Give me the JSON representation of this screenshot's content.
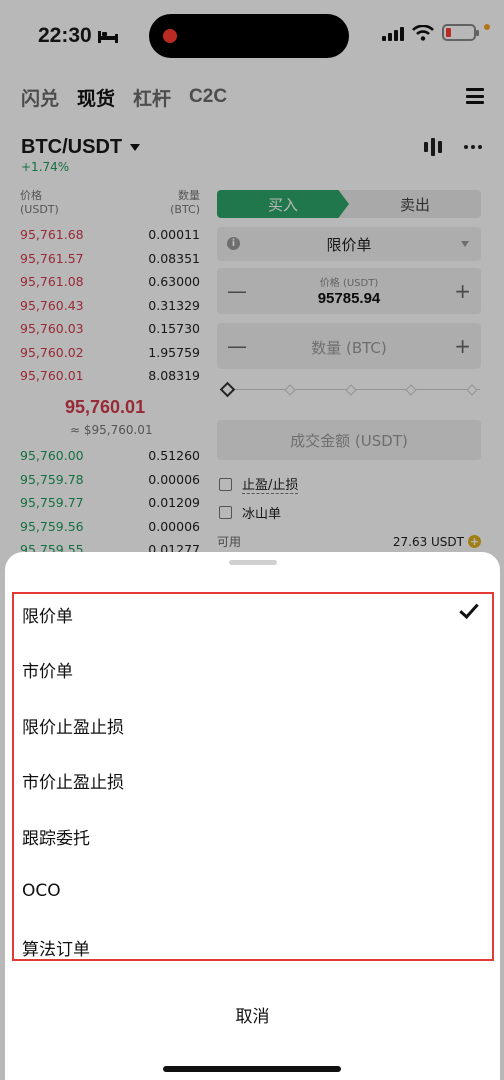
{
  "status": {
    "time": "22:30"
  },
  "nav": {
    "tabs": [
      "闪兑",
      "现货",
      "杠杆",
      "C2C"
    ],
    "active": 1
  },
  "pair": {
    "name": "BTC/USDT",
    "change": "+1.74%"
  },
  "orderbook": {
    "price_header": "价格",
    "price_unit": "(USDT)",
    "qty_header": "数量",
    "qty_unit": "(BTC)",
    "asks": [
      {
        "price": "95,761.68",
        "qty": "0.00011"
      },
      {
        "price": "95,761.57",
        "qty": "0.08351"
      },
      {
        "price": "95,761.08",
        "qty": "0.63000"
      },
      {
        "price": "95,760.43",
        "qty": "0.31329"
      },
      {
        "price": "95,760.03",
        "qty": "0.15730"
      },
      {
        "price": "95,760.02",
        "qty": "1.95759"
      },
      {
        "price": "95,760.01",
        "qty": "8.08319"
      }
    ],
    "mid_price": "95,760.01",
    "mid_approx": "≈ $95,760.01",
    "bids": [
      {
        "price": "95,760.00",
        "qty": "0.51260"
      },
      {
        "price": "95,759.78",
        "qty": "0.00006"
      },
      {
        "price": "95,759.77",
        "qty": "0.01209"
      },
      {
        "price": "95,759.56",
        "qty": "0.00006"
      },
      {
        "price": "95,759.55",
        "qty": "0.01277"
      }
    ]
  },
  "form": {
    "buy": "买入",
    "sell": "卖出",
    "order_type": "限价单",
    "price_label": "价格 (USDT)",
    "price_value": "95785.94",
    "qty_placeholder": "数量 (BTC)",
    "minus": "—",
    "plus": "+",
    "total_placeholder": "成交金额 (USDT)",
    "tp_sl": "止盈/止损",
    "iceberg": "冰山单",
    "available_label": "可用",
    "available_value": "27.63 USDT"
  },
  "sheet": {
    "options": [
      "限价单",
      "市价单",
      "限价止盈止损",
      "市价止盈止损",
      "跟踪委托",
      "OCO",
      "算法订单"
    ],
    "selected": 0,
    "cancel": "取消"
  },
  "colors": {
    "buy_green": "#2fa56a",
    "ask_red": "#d13b4c",
    "bid_green": "#1f9a5b",
    "highlight_red": "#e53935"
  }
}
